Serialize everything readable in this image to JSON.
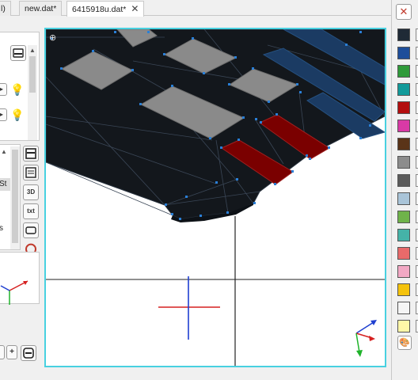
{
  "tabs": [
    {
      "label": "l)"
    },
    {
      "label": "new.dat*"
    },
    {
      "label": "6415918u.dat*",
      "close": "✕"
    }
  ],
  "left_panel": {
    "list_fragments": [
      "St",
      "s"
    ],
    "tool_buttons": [
      "3D",
      "txt"
    ],
    "bottom_buttons": [
      "+"
    ]
  },
  "palette": {
    "close_icon": "✕",
    "swatches": [
      "#1f2a36",
      "#1e4e9a",
      "#2f9a3a",
      "#129a9a",
      "#b30e0e",
      "#d83aa6",
      "#5a3418",
      "#8c8c8c",
      "#5a5a5a",
      "#a9c4d8",
      "#6fb34a",
      "#45b3a8",
      "#e86a6a",
      "#f2a8c4",
      "#f4c20c",
      "#f5f5f5",
      "#fff7a8"
    ],
    "paint_icon": "paint-palette"
  },
  "colors": {
    "selection_border": "#48d1e0",
    "model_fill": "#13171c",
    "grey_plate": "#8a8a8a",
    "blue_plate": "#1b3b63",
    "red_plate": "#7a0000",
    "vertex": "#2a7fd6"
  }
}
